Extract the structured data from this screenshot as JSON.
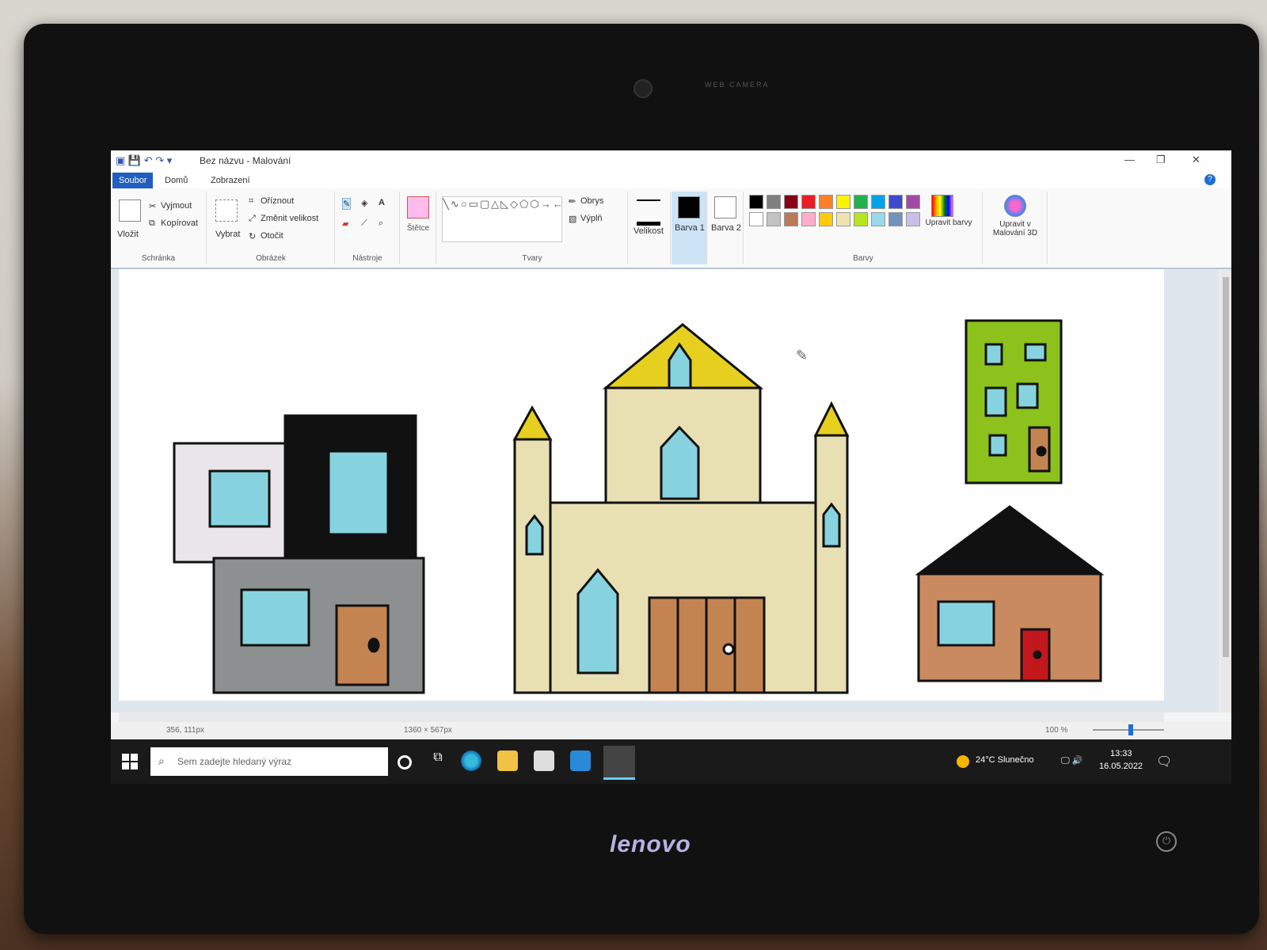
{
  "window": {
    "title": "Bez názvu - Malování"
  },
  "tabs": {
    "file": "Soubor",
    "home": "Domů",
    "view": "Zobrazení"
  },
  "ribbon": {
    "clipboard": {
      "label": "Schránka",
      "paste": "Vložit",
      "cut": "Vyjmout",
      "copy": "Kopírovat"
    },
    "image": {
      "label": "Obrázek",
      "select": "Vybrat",
      "crop": "Oříznout",
      "resize": "Změnit velikost",
      "rotate": "Otočit"
    },
    "tools": {
      "label": "Nástroje"
    },
    "brushes": {
      "label": "Štětce"
    },
    "shapes": {
      "label": "Tvary",
      "outline": "Obrys",
      "fill": "Výplň"
    },
    "size": {
      "label": "Velikost"
    },
    "color1": {
      "label": "Barva 1"
    },
    "color2": {
      "label": "Barva 2"
    },
    "colors": {
      "label": "Barvy",
      "edit": "Upravit barvy",
      "swatches_row1": [
        "#000000",
        "#7f7f7f",
        "#880015",
        "#ed1c24",
        "#ff7f27",
        "#fff200",
        "#22b14c",
        "#00a2e8",
        "#3f48cc",
        "#a349a4"
      ],
      "swatches_row2": [
        "#ffffff",
        "#c3c3c3",
        "#b97a57",
        "#ffaec9",
        "#ffc90e",
        "#efe4b0",
        "#b5e61d",
        "#99d9ea",
        "#7092be",
        "#c8bfe7"
      ]
    },
    "paint3d": {
      "label": "Upravit v Malování 3D"
    }
  },
  "status": {
    "cursor": "356, 111px",
    "size": "1360 × 567px",
    "zoom": "100 %"
  },
  "taskbar": {
    "search_placeholder": "Sem zadejte hledaný výraz",
    "weather": "24°C  Slunečno",
    "time": "13:33",
    "date": "16.05.2022"
  },
  "monitor": {
    "brand": "lenovo",
    "webcam": "WEB CAMERA"
  },
  "colors": {
    "window_blue": "#1f5fbf",
    "cream": "#e8dfb3",
    "yellow": "#e6cf1f",
    "cyan": "#86d3df",
    "brown": "#c48452",
    "green": "#8cc21b",
    "gray": "#8c9090",
    "red": "#c2181d",
    "black": "#111111"
  }
}
